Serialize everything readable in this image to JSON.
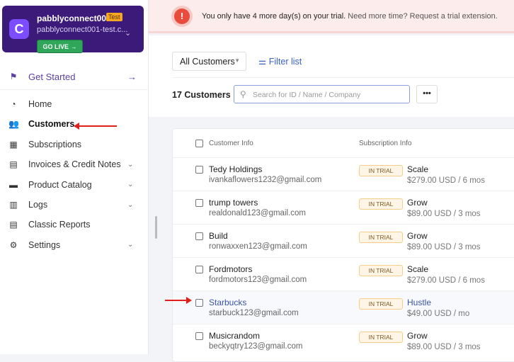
{
  "account": {
    "name": "pabblyconnect001",
    "badge": "Test",
    "url": "pabblyconnect001-test.c...",
    "go_live": "GO LIVE →"
  },
  "sidebar": {
    "get_started": "Get Started",
    "items": [
      {
        "label": "Home",
        "icon": "dashboard-icon",
        "chevron": false
      },
      {
        "label": "Customers",
        "icon": "users-icon",
        "chevron": false
      },
      {
        "label": "Subscriptions",
        "icon": "calendar-clock-icon",
        "chevron": false
      },
      {
        "label": "Invoices & Credit Notes",
        "icon": "invoice-icon",
        "chevron": true
      },
      {
        "label": "Product Catalog",
        "icon": "box-icon",
        "chevron": true
      },
      {
        "label": "Logs",
        "icon": "clipboard-icon",
        "chevron": true
      },
      {
        "label": "Classic Reports",
        "icon": "report-icon",
        "chevron": false
      },
      {
        "label": "Settings",
        "icon": "gear-icon",
        "chevron": true
      }
    ]
  },
  "banner": {
    "bold": "You only have 4 more day(s) on your trial.",
    "rest": " Need more time? Request a trial extension."
  },
  "toolbar": {
    "view": "All Customers",
    "filter": "Filter list",
    "count": "17 Customers",
    "search_placeholder": "Search for ID / Name / Company",
    "more": "•••"
  },
  "table": {
    "headers": [
      "Customer Info",
      "Subscription Info"
    ],
    "rows": [
      {
        "name": "Tedy Holdings",
        "email": "ivankaflowers1232@gmail.com",
        "status": "IN TRIAL",
        "plan": "Scale",
        "price": "$279.00 USD / 6 mos"
      },
      {
        "name": "trump towers",
        "email": "realdonald123@gmail.com",
        "status": "IN TRIAL",
        "plan": "Grow",
        "price": "$89.00 USD / 3 mos"
      },
      {
        "name": "Build",
        "email": "ronwaxxen123@gmail.com",
        "status": "IN TRIAL",
        "plan": "Grow",
        "price": "$89.00 USD / 3 mos"
      },
      {
        "name": "Fordmotors",
        "email": "fordmotors123@gmail.com",
        "status": "IN TRIAL",
        "plan": "Scale",
        "price": "$279.00 USD / 6 mos"
      },
      {
        "name": "Starbucks",
        "email": "starbuck123@gmail.com",
        "status": "IN TRIAL",
        "plan": "Hustle",
        "price": "$49.00 USD / mo"
      },
      {
        "name": "Musicrandom",
        "email": "beckyqtry123@gmail.com",
        "status": "IN TRIAL",
        "plan": "Grow",
        "price": "$89.00 USD / 3 mos"
      }
    ]
  },
  "colors": {
    "accent": "#3b1a7a",
    "link": "#3a62c9",
    "annotation": "#e0201b"
  }
}
